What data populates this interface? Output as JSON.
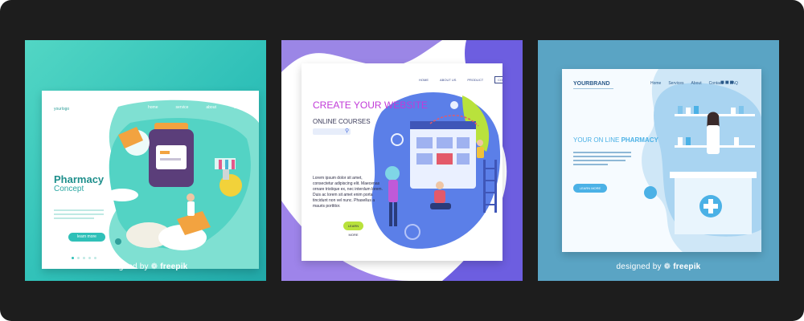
{
  "card1": {
    "logo": "yourlogo",
    "nav": [
      "home",
      "service",
      "about",
      "contact"
    ],
    "title": "Pharmacy",
    "subtitle": "Concept",
    "button": "learn more",
    "credit_prefix": "designed by",
    "credit_brand": "freepik",
    "colors": {
      "accent": "#2fc0b8",
      "title": "#1f8f8c"
    }
  },
  "card2": {
    "nav": [
      "HOME",
      "ABOUT US",
      "PRODUCT",
      "CONTACT"
    ],
    "title": "CREATE YOUR WEBSITE",
    "subtitle": "ONLINE COURSES",
    "body": "Lorem ipsum dolor sit amet, consectetur adipiscing elit. Maecenas ornare tristique ex, nec interdum lorem. Duis ac lorem sit amet enim porta tincidunt non vel nunc. Phasellus a mauris porttitor.",
    "button": "LEARN MORE",
    "colors": {
      "title": "#c13ad8",
      "accent": "#4a6fe0",
      "button": "#b9e23c"
    }
  },
  "card3": {
    "brand": "YOURBRAND",
    "nav": [
      "Home",
      "Services",
      "About",
      "Contact",
      "FAQ"
    ],
    "title_prefix": "YOUR ON LINE",
    "title_strong": "PHARMACY",
    "button": "LEARN MORE",
    "credit_prefix": "designed by",
    "credit_brand": "freepik",
    "colors": {
      "accent": "#4bb1e6",
      "background": "#5aa4c4"
    }
  }
}
